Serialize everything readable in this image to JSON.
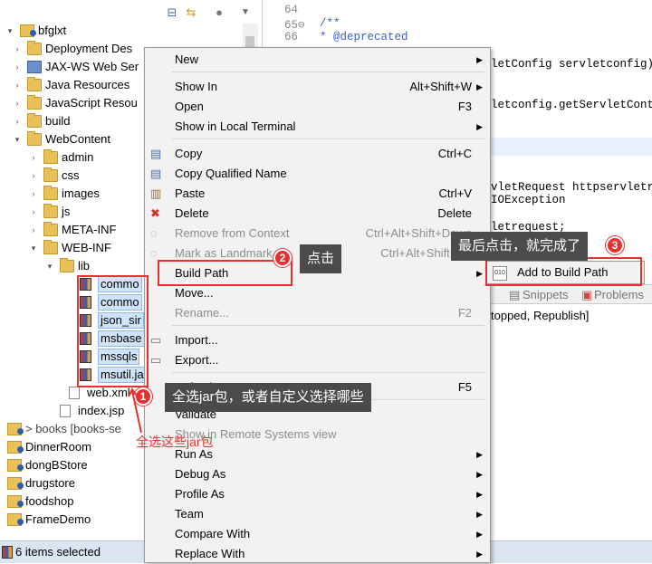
{
  "tree": {
    "items": [
      {
        "label": "bfglxt",
        "icon": "project-icon",
        "arrow": "▾"
      },
      {
        "label": "Deployment Des",
        "icon": "deployment-icon",
        "arrow": "›"
      },
      {
        "label": "JAX-WS Web Ser",
        "icon": "webservice-icon",
        "arrow": "›"
      },
      {
        "label": "Java Resources",
        "icon": "java-resources-icon",
        "arrow": "›"
      },
      {
        "label": "JavaScript Resou",
        "icon": "javascript-resources-icon",
        "arrow": "›"
      },
      {
        "label": "build",
        "icon": "folder-icon",
        "arrow": "›"
      },
      {
        "label": "WebContent",
        "icon": "webcontent-icon",
        "arrow": "▾"
      },
      {
        "label": "admin",
        "icon": "folder-icon",
        "arrow": "›"
      },
      {
        "label": "css",
        "icon": "folder-icon",
        "arrow": "›"
      },
      {
        "label": "images",
        "icon": "folder-icon",
        "arrow": "›"
      },
      {
        "label": "js",
        "icon": "folder-icon",
        "arrow": "›"
      },
      {
        "label": "META-INF",
        "icon": "folder-icon",
        "arrow": "›"
      },
      {
        "label": "WEB-INF",
        "icon": "folder-icon",
        "arrow": "▾"
      },
      {
        "label": "lib",
        "icon": "folder-icon",
        "arrow": "▾"
      },
      {
        "label": "commo",
        "icon": "jar-icon",
        "arrow": ""
      },
      {
        "label": "commo",
        "icon": "jar-icon",
        "arrow": ""
      },
      {
        "label": "json_sir",
        "icon": "jar-icon",
        "arrow": ""
      },
      {
        "label": "msbase",
        "icon": "jar-icon",
        "arrow": ""
      },
      {
        "label": "mssqls",
        "icon": "jar-icon",
        "arrow": ""
      },
      {
        "label": "msutil.ja",
        "icon": "jar-icon",
        "arrow": ""
      },
      {
        "label": "web.xml",
        "icon": "xml-file-icon",
        "arrow": ""
      },
      {
        "label": "index.jsp",
        "icon": "jsp-file-icon",
        "arrow": ""
      },
      {
        "label": "> books [books-se",
        "icon": "project-icon",
        "arrow": "›"
      },
      {
        "label": "DinnerRoom",
        "icon": "project-icon",
        "arrow": "›"
      },
      {
        "label": "dongBStore",
        "icon": "project-icon",
        "arrow": "›"
      },
      {
        "label": "drugstore",
        "icon": "project-icon",
        "arrow": "›"
      },
      {
        "label": "foodshop",
        "icon": "project-icon",
        "arrow": "›"
      },
      {
        "label": "FrameDemo",
        "icon": "project-icon",
        "arrow": "›"
      }
    ]
  },
  "status": {
    "text": "6 items selected"
  },
  "editor": {
    "lines": [
      {
        "num": "64",
        "code": ""
      },
      {
        "num": "65⊖",
        "code": "/**"
      },
      {
        "num": "66",
        "code": " * @deprecated"
      }
    ],
    "fragments": [
      "letConfig servletconfig)",
      "letconfig.getServletConte",
      "vletRequest httpservletre",
      "IOException",
      "letrequest;"
    ],
    "bottom_tabs": [
      "Snippets",
      "Problems"
    ],
    "console_text": "topped, Republish]"
  },
  "menu": {
    "items": [
      {
        "label": "New",
        "key": "",
        "submenu": true,
        "disabled": false,
        "icon": ""
      },
      {
        "label": "Show In",
        "key": "Alt+Shift+W",
        "submenu": true,
        "disabled": false,
        "icon": ""
      },
      {
        "label": "Open",
        "key": "F3",
        "submenu": false,
        "disabled": false,
        "icon": ""
      },
      {
        "label": "Show in Local Terminal",
        "key": "",
        "submenu": true,
        "disabled": false,
        "icon": ""
      },
      {
        "label": "Copy",
        "key": "Ctrl+C",
        "submenu": false,
        "disabled": false,
        "icon": "copy-icon"
      },
      {
        "label": "Copy Qualified Name",
        "key": "",
        "submenu": false,
        "disabled": false,
        "icon": "copy-qualified-icon"
      },
      {
        "label": "Paste",
        "key": "Ctrl+V",
        "submenu": false,
        "disabled": false,
        "icon": "paste-icon"
      },
      {
        "label": "Delete",
        "key": "Delete",
        "submenu": false,
        "disabled": false,
        "icon": "delete-icon"
      },
      {
        "label": "Remove from Context",
        "key": "Ctrl+Alt+Shift+Down",
        "submenu": false,
        "disabled": true,
        "icon": "remove-context-icon"
      },
      {
        "label": "Mark as Landmark",
        "key": "Ctrl+Alt+Shift+Up",
        "submenu": false,
        "disabled": true,
        "icon": "landmark-icon"
      },
      {
        "label": "Build Path",
        "key": "",
        "submenu": true,
        "disabled": false,
        "icon": ""
      },
      {
        "label": "Move...",
        "key": "",
        "submenu": false,
        "disabled": false,
        "icon": ""
      },
      {
        "label": "Rename...",
        "key": "F2",
        "submenu": false,
        "disabled": true,
        "icon": ""
      },
      {
        "label": "Import...",
        "key": "",
        "submenu": false,
        "disabled": false,
        "icon": "import-icon"
      },
      {
        "label": "Export...",
        "key": "",
        "submenu": false,
        "disabled": false,
        "icon": "export-icon"
      },
      {
        "label": "Refresh",
        "key": "F5",
        "submenu": false,
        "disabled": false,
        "icon": ""
      },
      {
        "label": "Validate",
        "key": "",
        "submenu": false,
        "disabled": false,
        "icon": ""
      },
      {
        "label": "Show in Remote Systems view",
        "key": "",
        "submenu": false,
        "disabled": true,
        "icon": ""
      },
      {
        "label": "Run As",
        "key": "",
        "submenu": true,
        "disabled": false,
        "icon": ""
      },
      {
        "label": "Debug As",
        "key": "",
        "submenu": true,
        "disabled": false,
        "icon": ""
      },
      {
        "label": "Profile As",
        "key": "",
        "submenu": true,
        "disabled": false,
        "icon": ""
      },
      {
        "label": "Team",
        "key": "",
        "submenu": true,
        "disabled": false,
        "icon": ""
      },
      {
        "label": "Compare With",
        "key": "",
        "submenu": true,
        "disabled": false,
        "icon": ""
      },
      {
        "label": "Replace With",
        "key": "",
        "submenu": true,
        "disabled": false,
        "icon": ""
      }
    ]
  },
  "submenu": {
    "label": "Add to Build Path",
    "icon": "add-build-path-icon"
  },
  "annotations": {
    "step1": {
      "num": "1",
      "tip": "全选jar包，或者自定义选择哪些"
    },
    "step2": {
      "num": "2",
      "tip": "点击"
    },
    "step3": {
      "num": "3",
      "tip": "最后点击，就完成了"
    },
    "red_note": "全选这些jar包"
  },
  "colors": {
    "annotation_red": "#e8312f",
    "tip_bg": "#4b4b4b",
    "selection": "#cfe4fb",
    "status_bg": "#dbe5f1"
  }
}
